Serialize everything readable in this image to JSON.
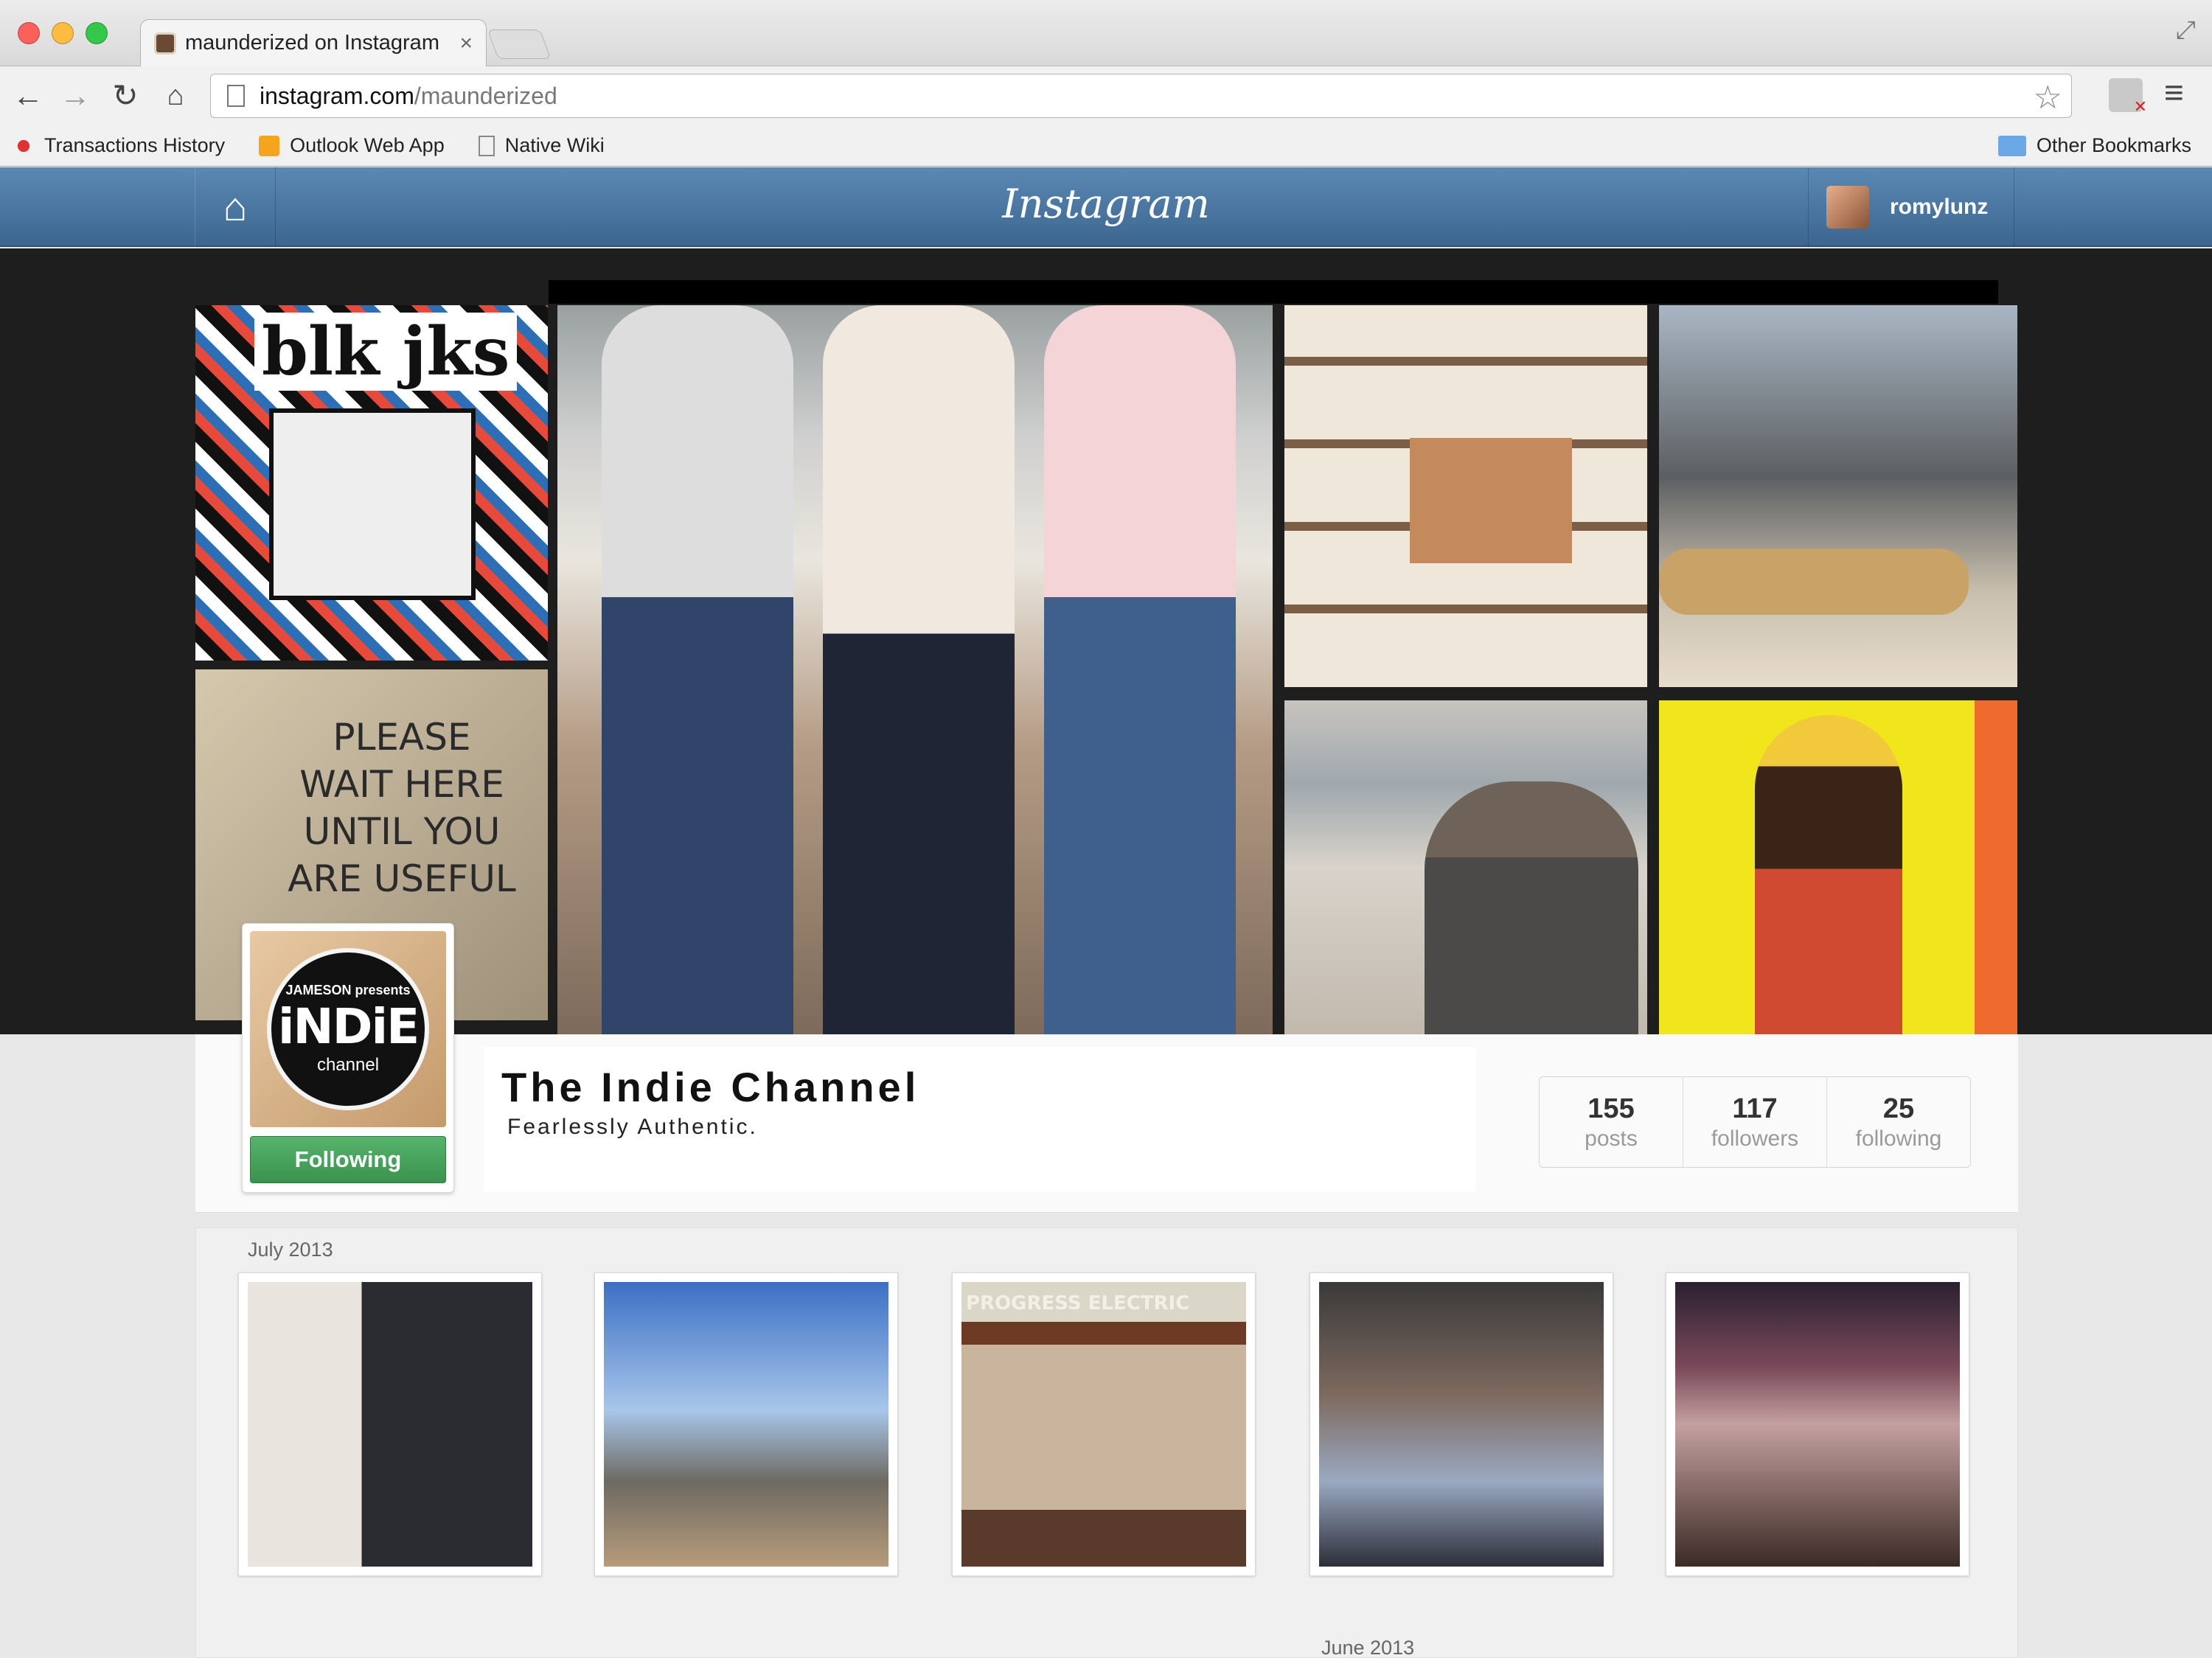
{
  "browser": {
    "tab_title": "maunderized on Instagram",
    "tab_close": "×",
    "url_host": "instagram.com",
    "url_path": "/maunderized",
    "bookmarks": [
      {
        "label": "Transactions History",
        "icon": "flower-icon"
      },
      {
        "label": "Outlook Web App",
        "icon": "outlook-icon"
      },
      {
        "label": "Native Wiki",
        "icon": "document-icon"
      }
    ],
    "other_bookmarks": "Other Bookmarks"
  },
  "header": {
    "logo": "Instagram",
    "username": "romylunz",
    "accent": "#3c6690"
  },
  "cover": {
    "photo_1_title": "blk jks",
    "photo_2_sign": "PLEASE WAIT HERE UNTIL YOU ARE USEFUL"
  },
  "profile": {
    "avatar": {
      "line1": "JAMESON presents",
      "line2": "iNDiE",
      "line3": "channel"
    },
    "follow_label": "Following",
    "follow_color": "#3a934e",
    "full_name": "The Indie Channel",
    "bio": "Fearlessly Authentic.",
    "stats": [
      {
        "num": "155",
        "label": "posts"
      },
      {
        "num": "117",
        "label": "followers"
      },
      {
        "num": "25",
        "label": "following"
      }
    ]
  },
  "feed": {
    "months": [
      "July 2013",
      "June 2013"
    ],
    "photo_3_text": "PROGRESS ELECTRIC"
  }
}
